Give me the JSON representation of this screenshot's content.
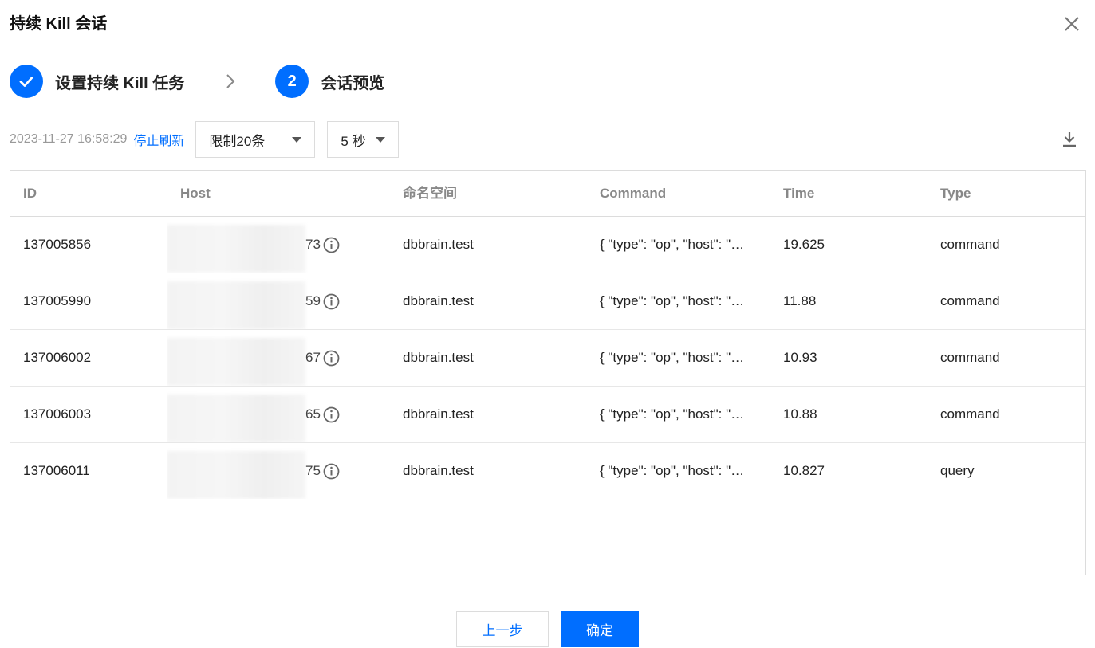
{
  "dialog": {
    "title": "持续 Kill 会话"
  },
  "steps": [
    {
      "number": "",
      "label": "设置持续 Kill 任务",
      "status": "done"
    },
    {
      "number": "2",
      "label": "会话预览",
      "status": "active"
    }
  ],
  "toolbar": {
    "timestamp": "2023-11-27 16:58:29",
    "stop_refresh": "停止刷新",
    "limit_select": "限制20条",
    "interval_select": "5 秒"
  },
  "table": {
    "columns": [
      "ID",
      "Host",
      "命名空间",
      "Command",
      "Time",
      "Type"
    ],
    "rows": [
      {
        "id": "137005856",
        "host_tail": "73",
        "namespace": "dbbrain.test",
        "command": "{ \"type\": \"op\", \"host\": \"…",
        "time": "19.625",
        "type": "command"
      },
      {
        "id": "137005990",
        "host_tail": "59",
        "namespace": "dbbrain.test",
        "command": "{ \"type\": \"op\", \"host\": \"…",
        "time": "11.88",
        "type": "command"
      },
      {
        "id": "137006002",
        "host_tail": "67",
        "namespace": "dbbrain.test",
        "command": "{ \"type\": \"op\", \"host\": \"…",
        "time": "10.93",
        "type": "command"
      },
      {
        "id": "137006003",
        "host_tail": "65",
        "namespace": "dbbrain.test",
        "command": "{ \"type\": \"op\", \"host\": \"…",
        "time": "10.88",
        "type": "command"
      },
      {
        "id": "137006011",
        "host_tail": "75",
        "namespace": "dbbrain.test",
        "command": "{ \"type\": \"op\", \"host\": \"…",
        "time": "10.827",
        "type": "query"
      }
    ]
  },
  "footer": {
    "prev_label": "上一步",
    "ok_label": "确定"
  },
  "colors": {
    "primary": "#006eff",
    "border": "#dcdcdc"
  },
  "icons": {
    "close": "close-icon",
    "check": "check-icon",
    "arrow": "chevron-right-icon",
    "download": "download-icon",
    "info": "info-icon",
    "caret": "caret-down-icon"
  }
}
